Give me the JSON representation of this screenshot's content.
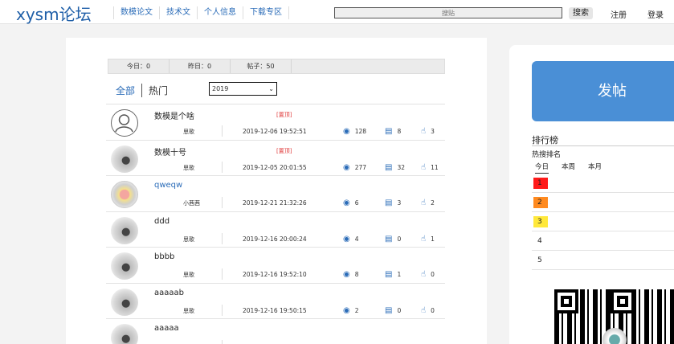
{
  "header": {
    "logo": "xysm论坛",
    "nav": [
      "数模论文",
      "技术文",
      "个人信息",
      "下载专区"
    ],
    "search_placeholder": "搜贴",
    "search_button": "搜索",
    "register": "注册",
    "login": "登录"
  },
  "stats": {
    "today": "今日：0",
    "yesterday": "昨日：0",
    "posts": "帖子：50"
  },
  "filter": {
    "tab_all": "全部",
    "tab_hot": "热门",
    "year": "2019"
  },
  "posts": [
    {
      "title": "数模是个啥",
      "pin": "[置顶]",
      "author": "思歌",
      "time": "2019-12-06 19:52:51",
      "views": "128",
      "comments": "8",
      "likes": "3",
      "avatar": "default-user-icon"
    },
    {
      "title": "数模十号",
      "pin": "[置顶]",
      "author": "思歌",
      "time": "2019-12-05 20:01:55",
      "views": "277",
      "comments": "32",
      "likes": "11",
      "avatar": "photo"
    },
    {
      "title": "qweqw",
      "pin": "",
      "author": "小茜茜",
      "time": "2019-12-21 21:32:26",
      "views": "6",
      "comments": "3",
      "likes": "2",
      "avatar": "star"
    },
    {
      "title": "ddd",
      "pin": "",
      "author": "思歌",
      "time": "2019-12-16 20:00:24",
      "views": "4",
      "comments": "0",
      "likes": "1",
      "avatar": "photo"
    },
    {
      "title": "bbbb",
      "pin": "",
      "author": "思歌",
      "time": "2019-12-16 19:52:10",
      "views": "8",
      "comments": "1",
      "likes": "0",
      "avatar": "photo"
    },
    {
      "title": "aaaaab",
      "pin": "",
      "author": "思歌",
      "time": "2019-12-16 19:50:15",
      "views": "2",
      "comments": "0",
      "likes": "0",
      "avatar": "photo"
    },
    {
      "title": "aaaaa",
      "pin": "",
      "author": "",
      "time": "",
      "views": "",
      "comments": "",
      "likes": "",
      "avatar": "photo"
    }
  ],
  "side": {
    "post_button": "发帖",
    "rank_title": "排行榜",
    "rank_sub": "热搜排名",
    "rank_tabs": [
      "今日",
      "本周",
      "本月"
    ],
    "rank_items": [
      {
        "num": "1",
        "color": "#ff1a1a"
      },
      {
        "num": "2",
        "color": "#ff8a1f"
      },
      {
        "num": "3",
        "color": "#ffe83a"
      },
      {
        "num": "4",
        "color": ""
      },
      {
        "num": "5",
        "color": ""
      }
    ]
  },
  "icons": {
    "views": "eye-icon",
    "comments": "comment-icon",
    "likes": "thumbs-up-icon",
    "dropdown": "chevron-down-icon"
  }
}
